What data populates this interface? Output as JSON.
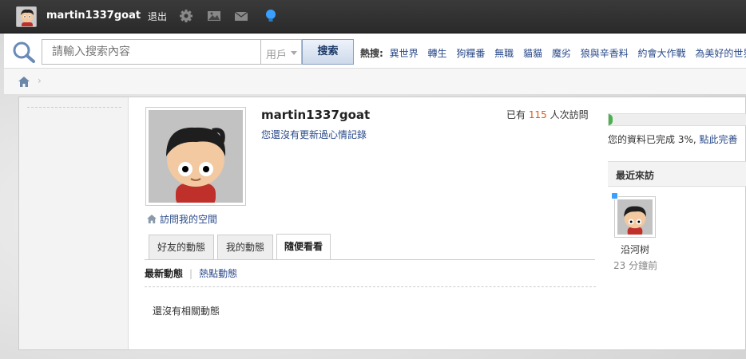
{
  "topbar": {
    "username": "martin1337goat",
    "logout_label": "退出",
    "icons": [
      "settings-icon",
      "image-icon",
      "mail-icon",
      "bulb-icon"
    ]
  },
  "search": {
    "placeholder": "請輸入搜索內容",
    "type_value": "用戶",
    "button_label": "搜索",
    "hot_label": "熱搜:",
    "hot_terms": [
      "異世界",
      "轉生",
      "狗糧番",
      "無職",
      "貓貓",
      "魔劣",
      "狼與辛香料",
      "約會大作戰",
      "為美好的世界獻上"
    ]
  },
  "profile": {
    "name": "martin1337goat",
    "mood_text": "您還沒有更新過心情記錄",
    "visits_prefix": "已有",
    "visits_count": "115",
    "visits_suffix": "人次訪問",
    "visit_space_label": "訪問我的空間"
  },
  "tabs": [
    {
      "label": "好友的動態",
      "active": false
    },
    {
      "label": "我的動態",
      "active": false
    },
    {
      "label": "隨便看看",
      "active": true
    }
  ],
  "filters": {
    "latest": "最新動態",
    "hot": "熱點動態"
  },
  "feed": {
    "empty_text": "還沒有相關動態"
  },
  "sidebar": {
    "profile_complete_percent": 3,
    "complete_text": "您的資料已完成 3%,",
    "complete_link": "點此完善",
    "recent_title": "最近來訪",
    "recent_visitors": [
      {
        "name": "沿河树",
        "time": "23 分鐘前",
        "online": true
      }
    ]
  },
  "colors": {
    "accent_link": "#2a4a8a",
    "count": "#e05a1a",
    "progress": "#4caf50",
    "online": "#3aa0ff"
  }
}
